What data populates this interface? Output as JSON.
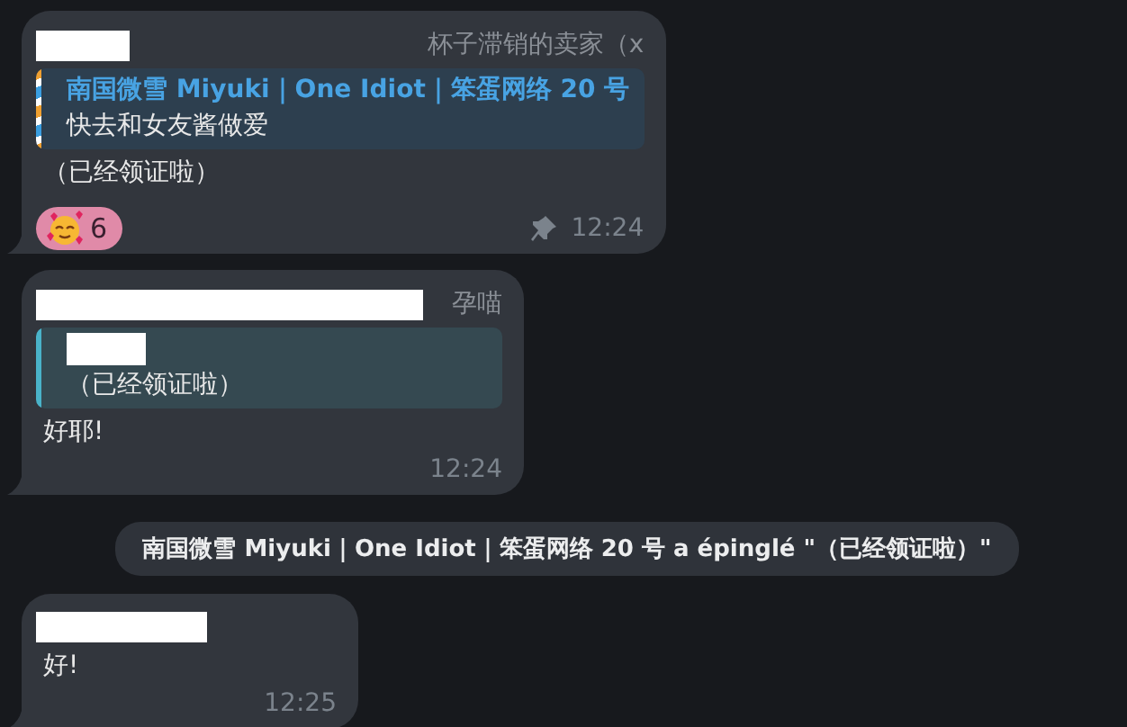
{
  "messages": [
    {
      "kind": "message",
      "sender_tag": "杯子滞销的卖家（x",
      "reply": {
        "title": "南国微雪 Miyuki｜One Idiot｜笨蛋网络 20 号",
        "text": "快去和女友酱做爱"
      },
      "text": "（已经领证啦）",
      "reactions": [
        {
          "count": "6"
        }
      ],
      "pinned": true,
      "time": "12:24"
    },
    {
      "kind": "message",
      "sender_tag": "孕喵",
      "reply": {
        "text": "（已经领证啦）"
      },
      "text": "好耶!",
      "pinned": false,
      "time": "12:24"
    },
    {
      "kind": "service",
      "text": "南国微雪 Miyuki｜One Idiot｜笨蛋网络 20 号 a épinglé \"（已经领证啦）\""
    },
    {
      "kind": "message",
      "text": "好!",
      "pinned": false,
      "time": "12:25"
    }
  ]
}
